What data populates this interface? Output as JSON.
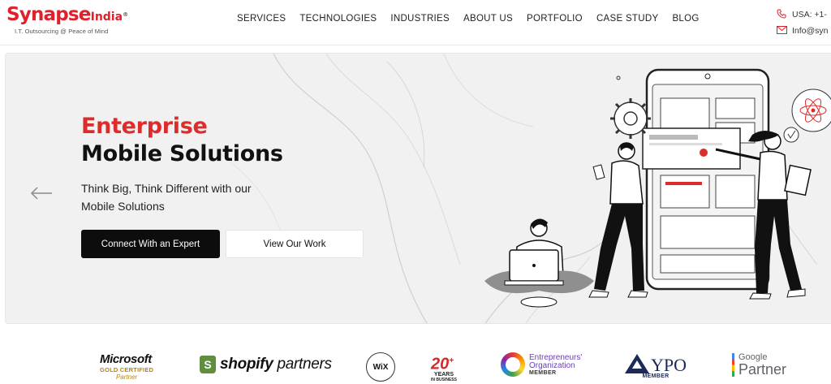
{
  "brand": {
    "name_main": "Synapse",
    "name_suffix": "India",
    "tagline": "I.T. Outsourcing @ Peace of Mind"
  },
  "nav": [
    "SERVICES",
    "TECHNOLOGIES",
    "INDUSTRIES",
    "ABOUT US",
    "PORTFOLIO",
    "CASE STUDY",
    "BLOG"
  ],
  "contact": {
    "phone": "USA: +1-",
    "email": "Info@syn"
  },
  "hero": {
    "title_accent": "Enterprise",
    "title_main": "Mobile Solutions",
    "subtitle": "Think Big, Think Different with our Mobile Solutions",
    "primary_button": "Connect With an Expert",
    "secondary_button": "View Our Work"
  },
  "partners": {
    "microsoft": {
      "name": "Microsoft",
      "tier": "GOLD CERTIFIED",
      "role": "Partner"
    },
    "shopify": {
      "brand": "shopify",
      "suffix": "partners"
    },
    "wix": {
      "label": "WiX"
    },
    "years": {
      "number": "20",
      "plus": "+",
      "label": "YEARS",
      "sub": "IN BUSINESS"
    },
    "eo": {
      "line1": "Entrepreneurs'",
      "line2": "Organization",
      "member": "MEMBER"
    },
    "ypo": {
      "name": "YPO",
      "member": "MEMBER"
    },
    "google": {
      "brand": "Google",
      "role": "Partner"
    }
  },
  "colors": {
    "brand_red": "#e0202a",
    "accent_red": "#dd2c2c",
    "hero_bg": "#f1f1f1",
    "button_dark": "#0d0d0d"
  },
  "icons": {
    "phone": "phone-icon",
    "mail": "mail-icon",
    "prev": "arrow-left-icon"
  }
}
